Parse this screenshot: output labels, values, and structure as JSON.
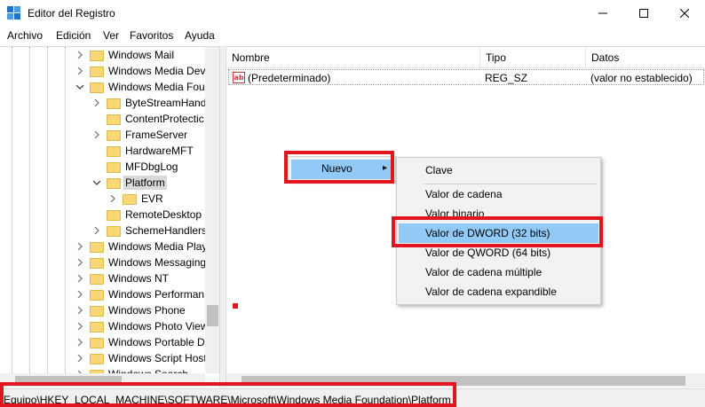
{
  "window": {
    "title": "Editor del Registro",
    "icon": "regedit-icon",
    "controls": [
      "minimize-icon",
      "maximize-icon",
      "close-icon"
    ]
  },
  "menubar": {
    "items": [
      "Archivo",
      "Edición",
      "Ver",
      "Favoritos",
      "Ayuda"
    ]
  },
  "tree": {
    "items": [
      {
        "label": "Windows Mail",
        "level": 0,
        "expander": "collapsed"
      },
      {
        "label": "Windows Media Dev",
        "level": 0,
        "expander": "collapsed"
      },
      {
        "label": "Windows Media Fou",
        "level": 0,
        "expander": "expanded"
      },
      {
        "label": "ByteStreamHand",
        "level": 1,
        "expander": "collapsed"
      },
      {
        "label": "ContentProtectic",
        "level": 1,
        "expander": "none"
      },
      {
        "label": "FrameServer",
        "level": 1,
        "expander": "collapsed"
      },
      {
        "label": "HardwareMFT",
        "level": 1,
        "expander": "none"
      },
      {
        "label": "MFDbgLog",
        "level": 1,
        "expander": "none"
      },
      {
        "label": "Platform",
        "level": 1,
        "expander": "expanded",
        "selected": true
      },
      {
        "label": "EVR",
        "level": 2,
        "expander": "collapsed"
      },
      {
        "label": "RemoteDesktop",
        "level": 1,
        "expander": "none"
      },
      {
        "label": "SchemeHandlers",
        "level": 1,
        "expander": "collapsed"
      },
      {
        "label": "Windows Media Play",
        "level": 0,
        "expander": "collapsed"
      },
      {
        "label": "Windows Messaging",
        "level": 0,
        "expander": "collapsed"
      },
      {
        "label": "Windows NT",
        "level": 0,
        "expander": "collapsed"
      },
      {
        "label": "Windows Performan",
        "level": 0,
        "expander": "collapsed"
      },
      {
        "label": "Windows Phone",
        "level": 0,
        "expander": "collapsed"
      },
      {
        "label": "Windows Photo View",
        "level": 0,
        "expander": "collapsed"
      },
      {
        "label": "Windows Portable D",
        "level": 0,
        "expander": "collapsed"
      },
      {
        "label": "Windows Script Host",
        "level": 0,
        "expander": "collapsed"
      },
      {
        "label": "Windows Search",
        "level": 0,
        "expander": "collapsed"
      }
    ]
  },
  "listview": {
    "columns": [
      "Nombre",
      "Tipo",
      "Datos"
    ],
    "rows": [
      {
        "name": "(Predeterminado)",
        "type": "REG_SZ",
        "data": "(valor no establecido)",
        "icon": "string-value-icon"
      }
    ]
  },
  "context_menu": {
    "parent_label": "Nuevo",
    "submenu": [
      {
        "label": "Clave"
      },
      {
        "separator": true
      },
      {
        "label": "Valor de cadena"
      },
      {
        "label": "Valor binario"
      },
      {
        "label": "Valor de DWORD (32 bits)",
        "highlighted": true
      },
      {
        "label": "Valor de QWORD (64 bits)"
      },
      {
        "label": "Valor de cadena múltiple"
      },
      {
        "label": "Valor de cadena expandible"
      }
    ]
  },
  "statusbar": {
    "path": "Equipo\\HKEY_LOCAL_MACHINE\\SOFTWARE\\Microsoft\\Windows Media Foundation\\Platform"
  },
  "colors": {
    "highlight": "#91c9f7",
    "annotation_red": "#e0151f",
    "folder_yellow": "#f8d775",
    "tree_selected": "#d9d9d9"
  }
}
